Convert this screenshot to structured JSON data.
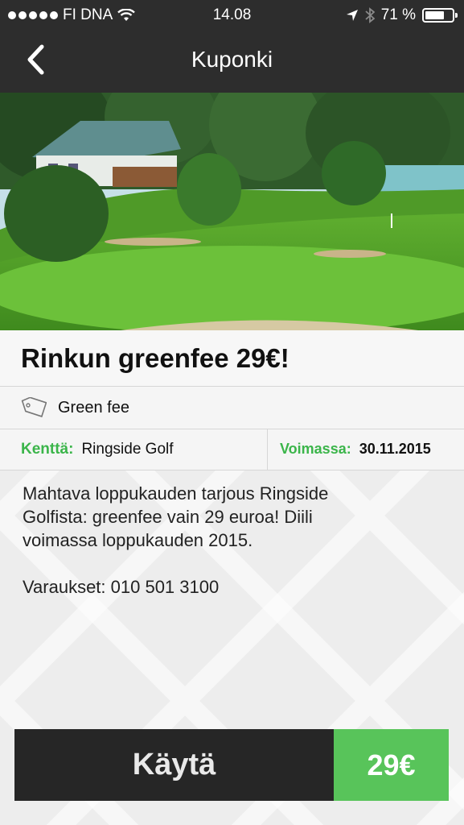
{
  "status_bar": {
    "carrier": "FI DNA",
    "time": "14.08",
    "battery_percent": "71 %",
    "battery_level": 0.71
  },
  "nav": {
    "title": "Kuponki",
    "back_icon": "chevron-left-icon"
  },
  "hero_image": {
    "subject": "golf-course-with-clubhouse"
  },
  "coupon": {
    "title": "Rinkun greenfee 29€!",
    "category_icon": "tag-icon",
    "category": "Green fee",
    "course_label": "Kenttä:",
    "course_value": "Ringside Golf",
    "valid_label": "Voimassa:",
    "valid_value": "30.11.2015",
    "description_lines": [
      "Mahtava loppukauden tarjous Ringside",
      "Golfista: greenfee vain 29 euroa! Diili",
      "voimassa loppukauden 2015."
    ],
    "booking": "Varaukset: 010 501 3100"
  },
  "cta": {
    "use_label": "Käytä",
    "price": "29€"
  },
  "colors": {
    "topbar": "#2d2d2d",
    "accent_green": "#3bb54a",
    "price_green": "#58c45a",
    "cta_dark": "#262626"
  }
}
